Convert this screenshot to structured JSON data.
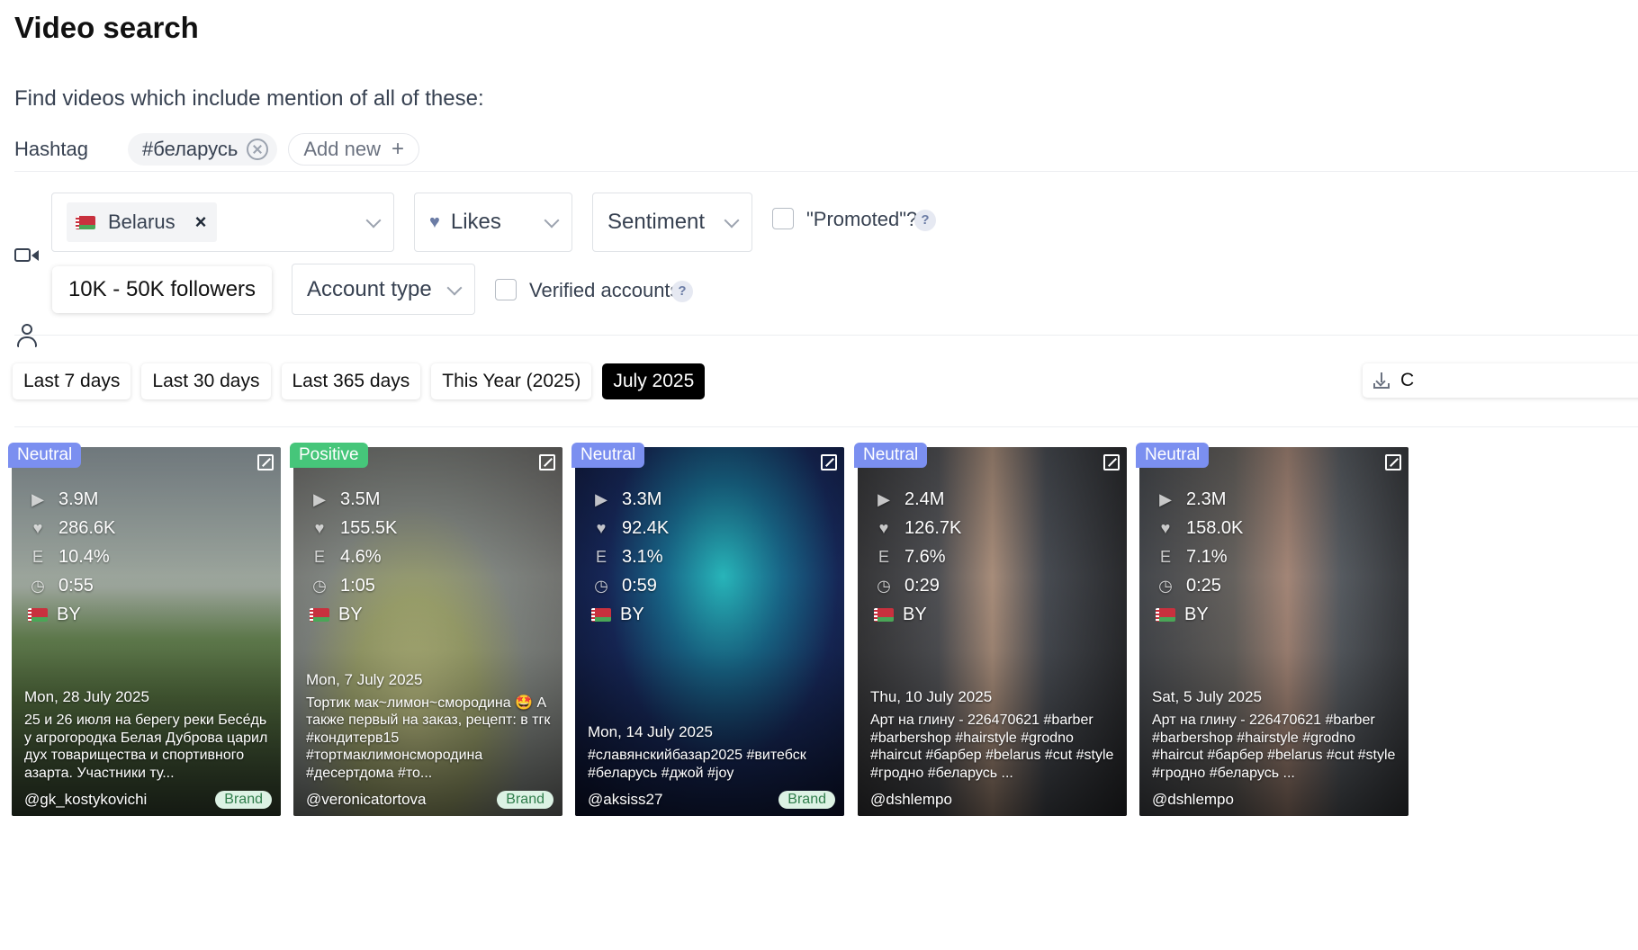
{
  "page": {
    "title": "Video search",
    "subtitle": "Find videos which include mention of all of these:"
  },
  "hashtag": {
    "label": "Hashtag",
    "tag": "#беларусь",
    "add_label": "Add new"
  },
  "filters": {
    "country": "Belarus",
    "likes": "Likes",
    "sentiment": "Sentiment",
    "promoted_label": "\"Promoted\"?",
    "followers": "10K - 50K followers",
    "account_type": "Account type",
    "verified_label": "Verified accounts",
    "help": "?"
  },
  "date_ranges": [
    "Last 7 days",
    "Last 30 days",
    "Last 365 days",
    "This Year (2025)",
    "July 2025"
  ],
  "active_range": "July 2025",
  "download_label": "C",
  "sentiment_colors": {
    "Neutral": "#7b8ff0",
    "Positive": "#46c67a"
  },
  "cards": [
    {
      "sentiment": "Neutral",
      "views": "3.9M",
      "likes": "286.6K",
      "engagement": "10.4%",
      "duration": "0:55",
      "country": "BY",
      "date": "Mon, 28 July 2025",
      "description": "25 и 26 июля на берегу реки Бесе́дь у агрогородка Белая Дуброва царил дух товарищества и спортивного азарта. Участники ту...",
      "author": "@gk_kostykovichi",
      "brand": "Brand"
    },
    {
      "sentiment": "Positive",
      "views": "3.5M",
      "likes": "155.5K",
      "engagement": "4.6%",
      "duration": "1:05",
      "country": "BY",
      "date": "Mon, 7 July 2025",
      "description": "Тортик мак~лимон~смородина 🤩 А также первый на заказ, рецепт: в тгк #кондитерв15 #тортмаклимонсмородина #десертдома #то...",
      "author": "@veronicatortova",
      "brand": "Brand"
    },
    {
      "sentiment": "Neutral",
      "views": "3.3M",
      "likes": "92.4K",
      "engagement": "3.1%",
      "duration": "0:59",
      "country": "BY",
      "date": "Mon, 14 July 2025",
      "description": "#славянскийбазар2025 #витебск #беларусь #джой #joy",
      "author": "@aksiss27",
      "brand": "Brand"
    },
    {
      "sentiment": "Neutral",
      "views": "2.4M",
      "likes": "126.7K",
      "engagement": "7.6%",
      "duration": "0:29",
      "country": "BY",
      "date": "Thu, 10 July 2025",
      "description": "Арт на глину - 226470621 #barber #barbershop #hairstyle #grodno #haircut #барбер #belarus #cut #style #гродно #беларусь ...",
      "author": "@dshlempo",
      "brand": ""
    },
    {
      "sentiment": "Neutral",
      "views": "2.3M",
      "likes": "158.0K",
      "engagement": "7.1%",
      "duration": "0:25",
      "country": "BY",
      "date": "Sat, 5 July 2025",
      "description": "Арт на глину - 226470621 #barber #barbershop #hairstyle #grodno #haircut #барбер #belarus #cut #style #гродно #беларусь ...",
      "author": "@dshlempo",
      "brand": ""
    }
  ]
}
